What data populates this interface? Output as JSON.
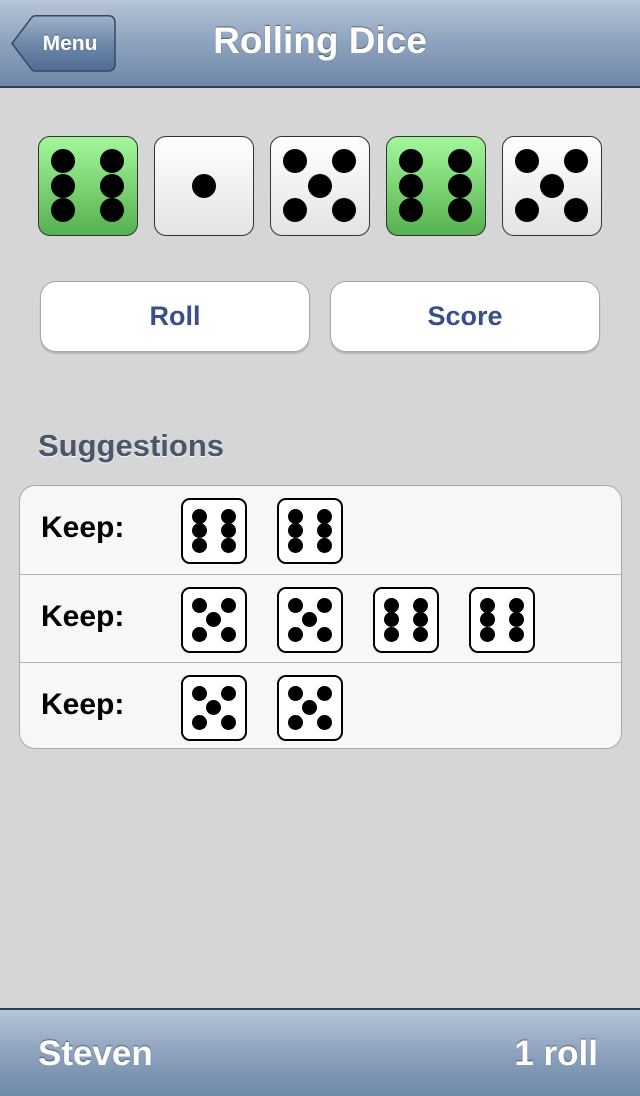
{
  "nav": {
    "title": "Rolling Dice",
    "back_label": "Menu"
  },
  "dice": [
    {
      "value": 6,
      "held": true
    },
    {
      "value": 1,
      "held": false
    },
    {
      "value": 5,
      "held": false
    },
    {
      "value": 6,
      "held": true
    },
    {
      "value": 5,
      "held": false
    }
  ],
  "buttons": {
    "roll_label": "Roll",
    "score_label": "Score"
  },
  "suggestions": {
    "title": "Suggestions",
    "rows": [
      {
        "label": "Keep:",
        "dice": [
          6,
          6
        ]
      },
      {
        "label": "Keep:",
        "dice": [
          5,
          5,
          6,
          6
        ]
      },
      {
        "label": "Keep:",
        "dice": [
          5,
          5
        ]
      }
    ]
  },
  "footer": {
    "player": "Steven",
    "rolls": "1 roll"
  },
  "colors": {
    "held_die": "#6fd468",
    "button_text": "#38508a",
    "bar": "#8da2bd"
  }
}
